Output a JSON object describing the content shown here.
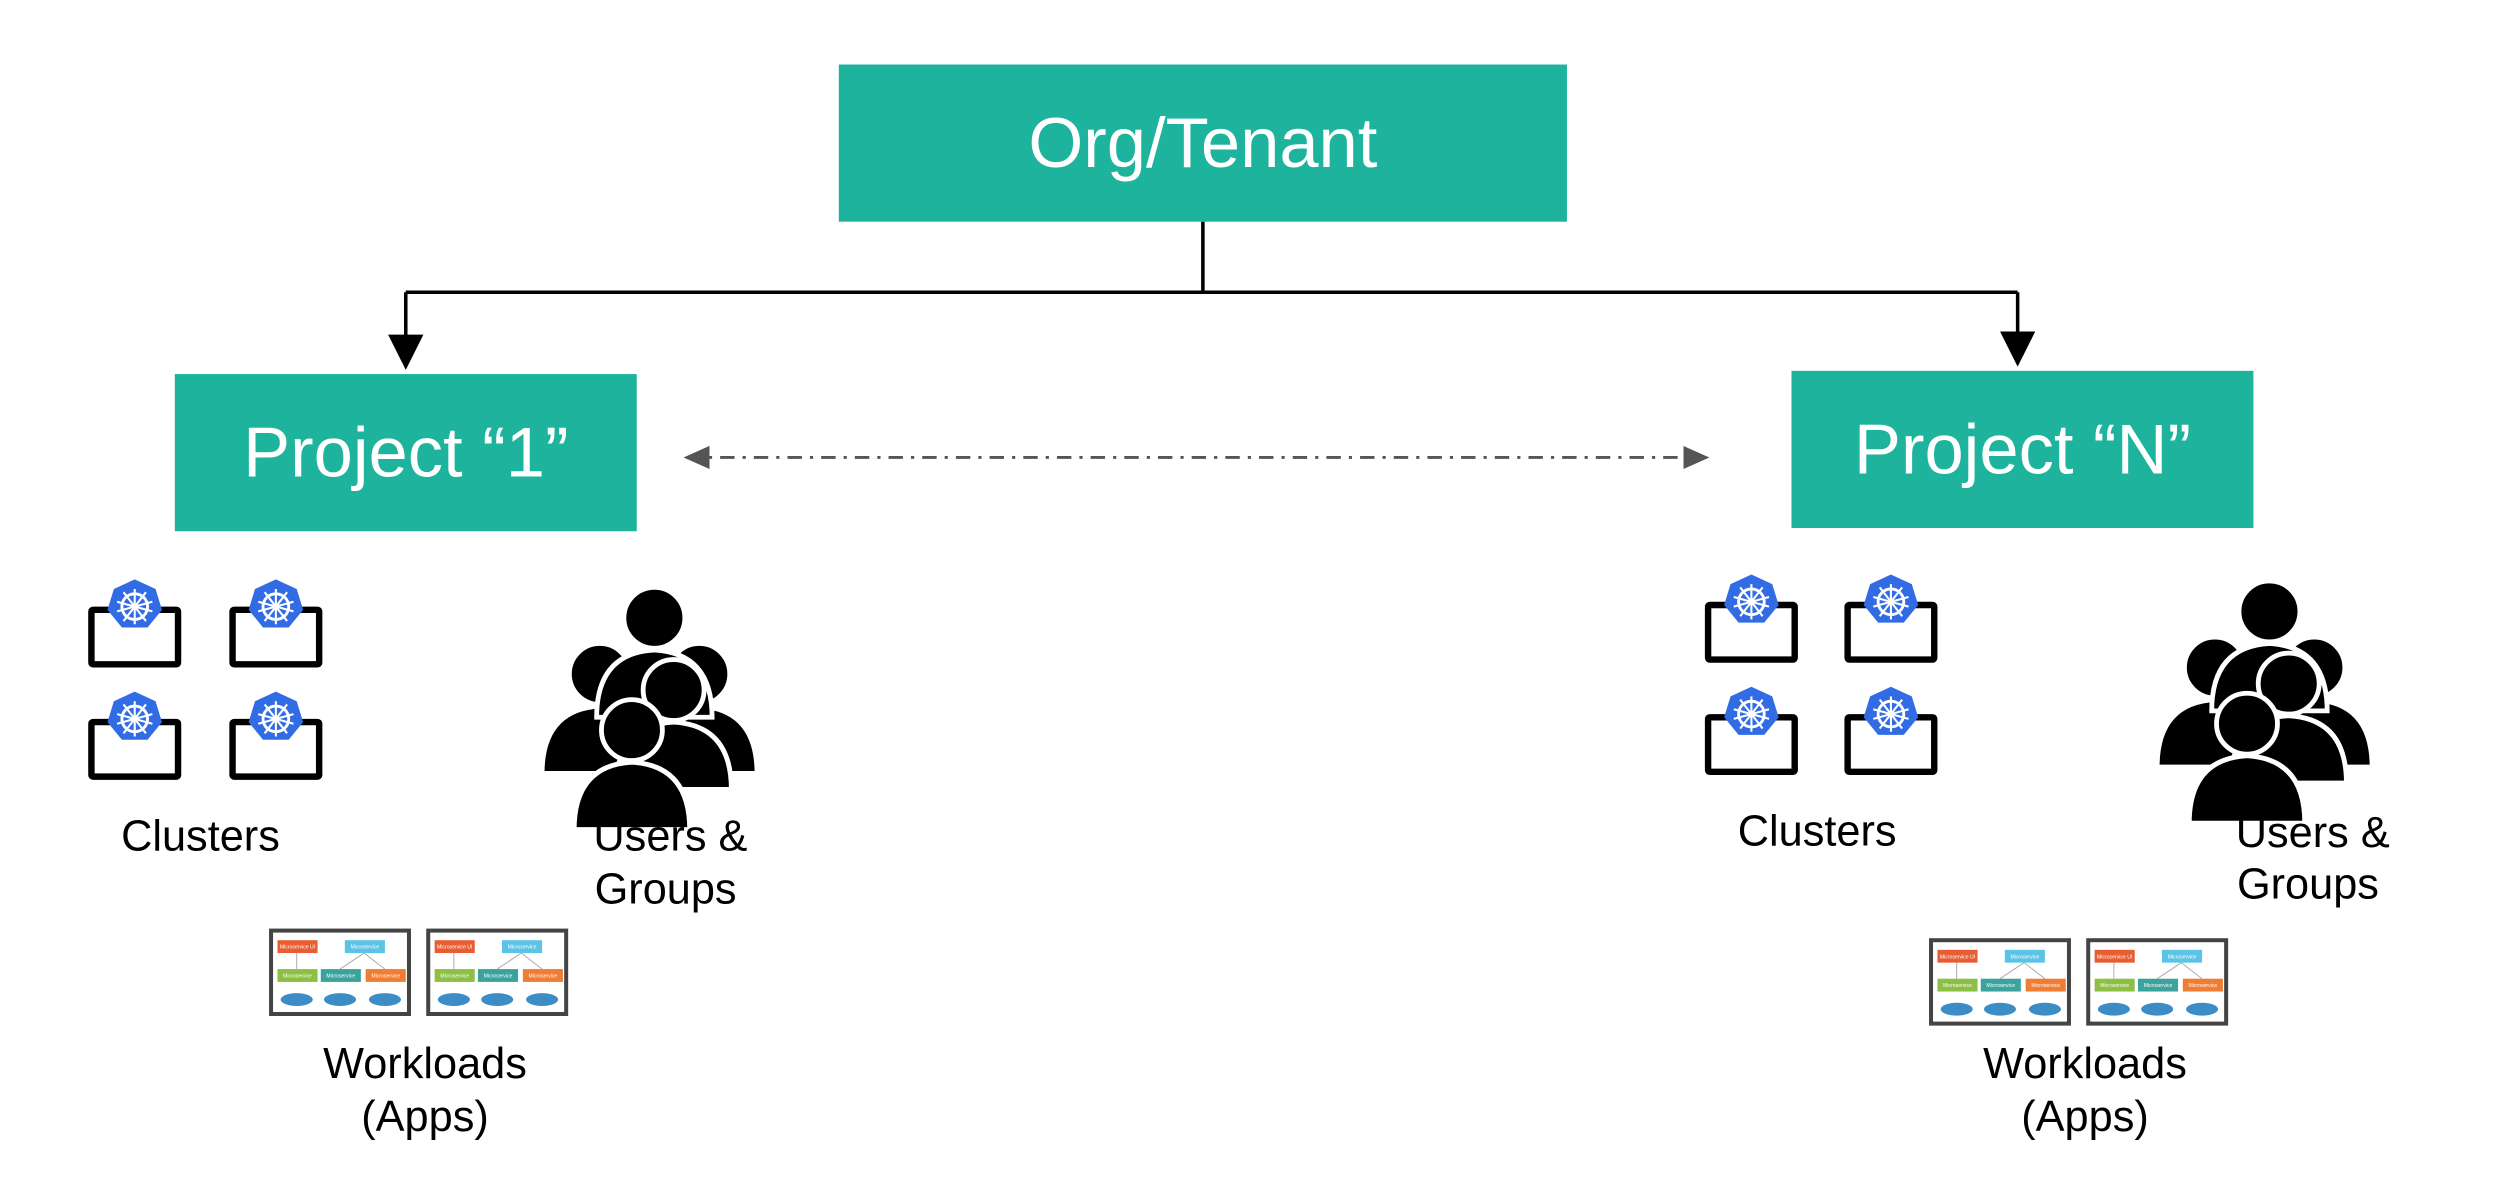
{
  "colors": {
    "box": "#1DB39D",
    "k8s": "#326CE5",
    "line": "#000000",
    "dashed": "#555555"
  },
  "org": {
    "label": "Org/Tenant"
  },
  "projects": [
    {
      "label": "Project “1”",
      "clusters_label": "Clusters",
      "users_label_1": "Users &",
      "users_label_2": "Groups",
      "workloads_label_1": "Workloads",
      "workloads_label_2": "(Apps)"
    },
    {
      "label": "Project “N”",
      "clusters_label": "Clusters",
      "users_label_1": "Users &",
      "users_label_2": "Groups",
      "workloads_label_1": "Workloads",
      "workloads_label_2": "(Apps)"
    }
  ],
  "workload_thumb": {
    "top_left": "Microservice UI",
    "top_right": "Microservice",
    "bottom": [
      "Microservice",
      "Microservice",
      "Microservice"
    ]
  },
  "icons": {
    "cluster": "kubernetes-monitor-icon",
    "users": "user-group-icon",
    "workload": "microservice-diagram-icon"
  }
}
